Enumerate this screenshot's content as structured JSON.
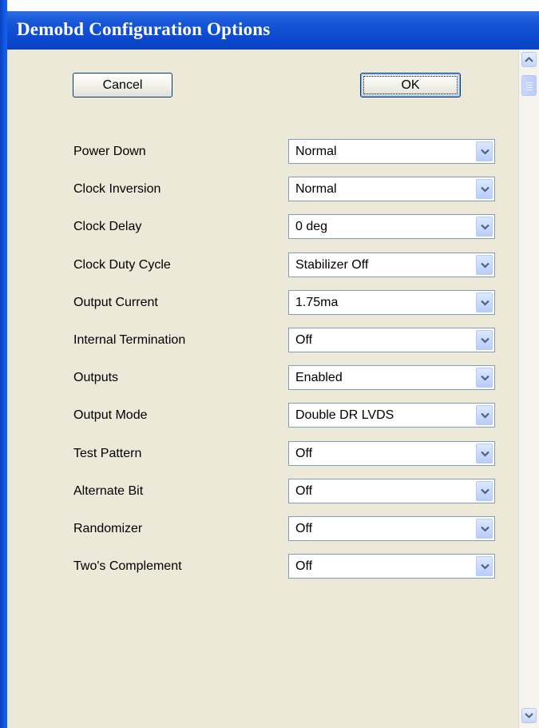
{
  "window": {
    "title": "Demobd Configuration Options"
  },
  "buttons": {
    "cancel_label": "Cancel",
    "ok_label": "OK"
  },
  "options": [
    {
      "label": "Power Down",
      "value": "Normal"
    },
    {
      "label": "Clock Inversion",
      "value": "Normal"
    },
    {
      "label": "Clock Delay",
      "value": "0 deg"
    },
    {
      "label": "Clock Duty Cycle",
      "value": "Stabilizer Off"
    },
    {
      "label": "Output Current",
      "value": "1.75ma"
    },
    {
      "label": "Internal Termination",
      "value": "Off"
    },
    {
      "label": "Outputs",
      "value": "Enabled"
    },
    {
      "label": "Output Mode",
      "value": "Double DR LVDS"
    },
    {
      "label": "Test Pattern",
      "value": "Off"
    },
    {
      "label": "Alternate Bit",
      "value": "Off"
    },
    {
      "label": "Randomizer",
      "value": "Off"
    },
    {
      "label": "Two's Complement",
      "value": "Off"
    }
  ],
  "scrollbar": {
    "up_icon": "scroll-up-arrow",
    "down_icon": "scroll-down-arrow"
  }
}
